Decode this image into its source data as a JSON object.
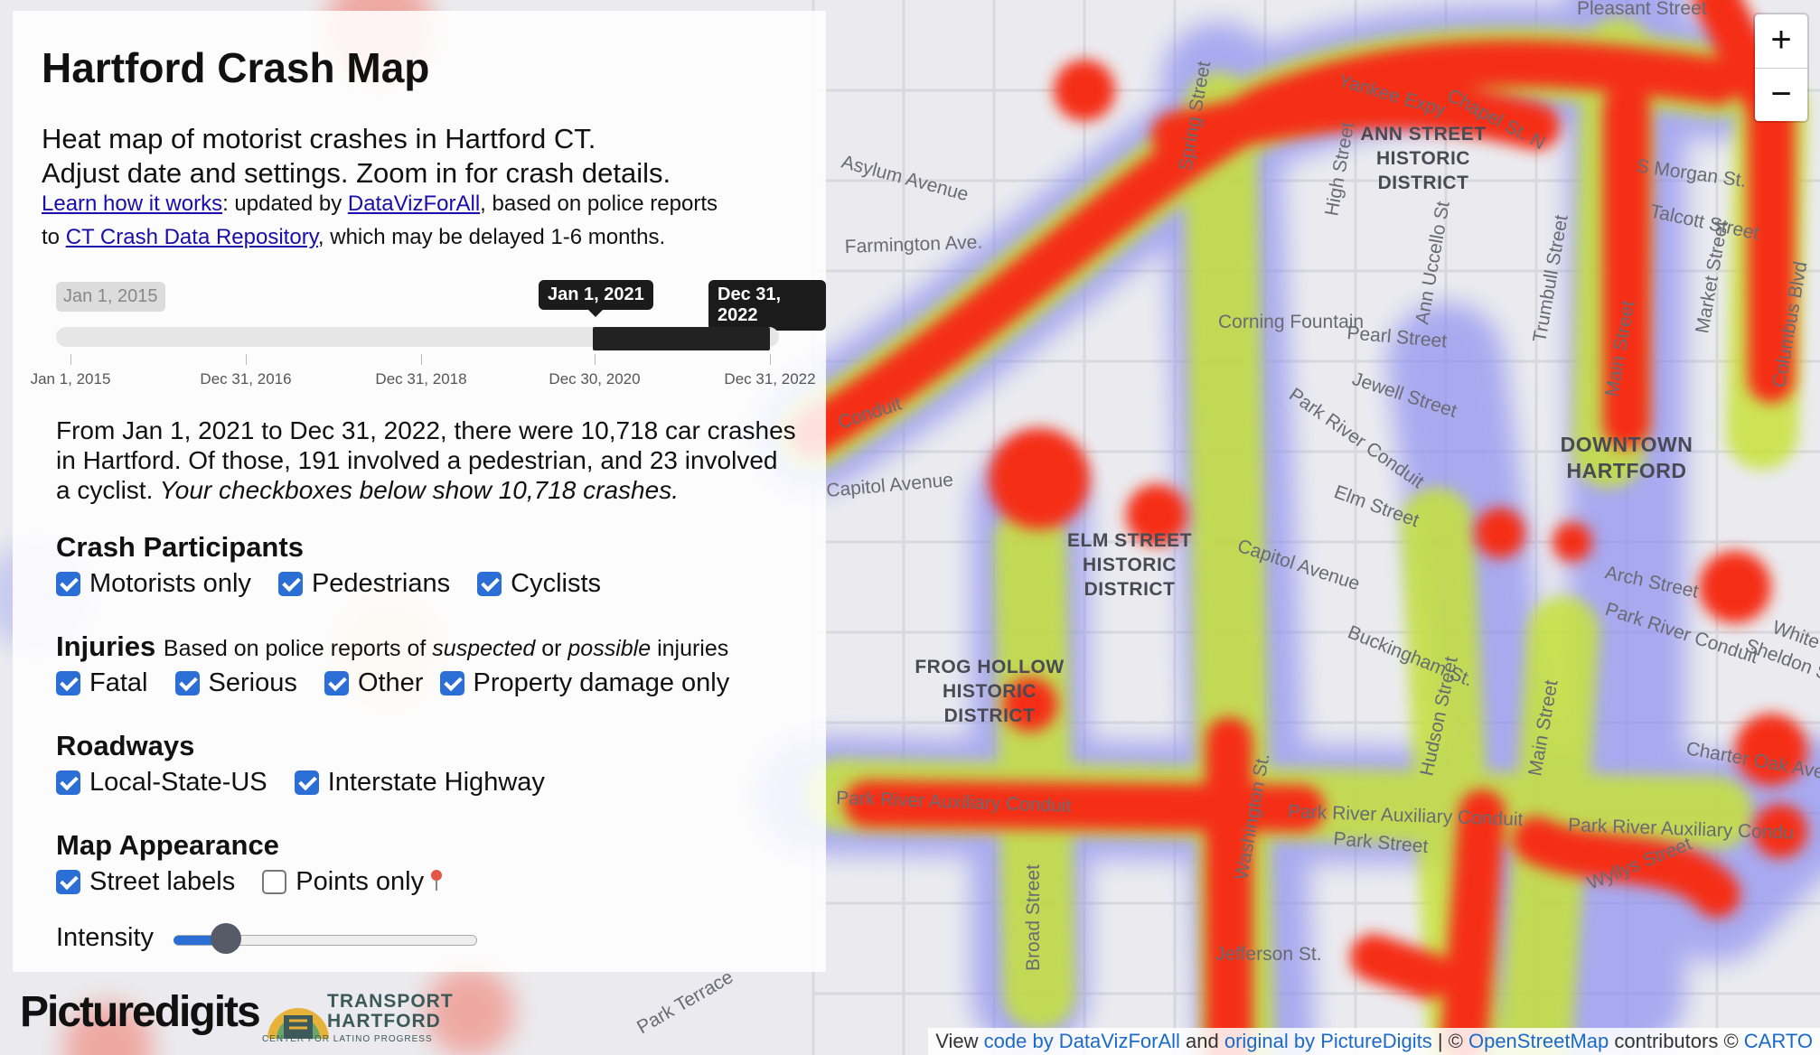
{
  "app": {
    "title": "Hartford Crash Map",
    "intro_line1": "Heat map of motorist crashes in Hartford CT.",
    "intro_line2": "Adjust date and settings. Zoom in for crash details.",
    "learn_link": "Learn how it works",
    "credit_mid": ": updated by ",
    "datavizforall_link": "DataVizForAll",
    "credit_after": ", based on police reports",
    "credit_to": "to ",
    "repo_link": "CT Crash Data Repository",
    "credit_end": ", which may be delayed 1-6 months."
  },
  "date_slider": {
    "min_label": "Jan 1, 2015",
    "start_label": "Jan 1, 2021",
    "end_label": "Dec 31, 2022",
    "ticks": [
      "Jan 1, 2015",
      "Dec 31, 2016",
      "Dec 31, 2018",
      "Dec 30, 2020",
      "Dec 31, 2022"
    ]
  },
  "summary": {
    "text": "From Jan 1, 2021 to Dec 31, 2022, there were 10,718 car crashes in Hartford. Of those, 191 involved a pedestrian, and 23 involved a cyclist.",
    "italic": " Your checkboxes below show 10,718 crashes."
  },
  "participants": {
    "heading": "Crash Participants",
    "options": [
      {
        "label": "Motorists only",
        "checked": true
      },
      {
        "label": "Pedestrians",
        "checked": true
      },
      {
        "label": "Cyclists",
        "checked": true
      }
    ]
  },
  "injuries": {
    "heading": "Injuries",
    "note_pre": "Based on police reports of ",
    "note_em1": "suspected",
    "note_mid": " or ",
    "note_em2": "possible",
    "note_post": " injuries",
    "options": [
      {
        "label": "Fatal",
        "checked": true
      },
      {
        "label": "Serious",
        "checked": true
      },
      {
        "label": "Other",
        "checked": true
      },
      {
        "label": "Property damage only",
        "checked": true
      }
    ]
  },
  "roadways": {
    "heading": "Roadways",
    "options": [
      {
        "label": "Local-State-US",
        "checked": true
      },
      {
        "label": "Interstate Highway",
        "checked": true
      }
    ]
  },
  "appearance": {
    "heading": "Map Appearance",
    "street_labels": {
      "label": "Street labels",
      "checked": true
    },
    "points_only": {
      "label": "Points only",
      "checked": false
    },
    "intensity_label": "Intensity",
    "intensity_value": 0.15
  },
  "logos": {
    "picturedigits": "Picturedigits",
    "transport_line1": "TRANSPORT",
    "transport_line2": "HARTFORD",
    "transport_sub": "CENTER FOR LATINO PROGRESS"
  },
  "zoom": {
    "in": "+",
    "out": "−"
  },
  "attribution": {
    "view": "View ",
    "code_link": "code by DataVizForAll",
    "and": " and ",
    "original_link": "original by PictureDigits",
    "sep": " | © ",
    "osm_link": "OpenStreetMap",
    "contrib": " contributors © ",
    "carto_link": "CARTO"
  },
  "map_labels": {
    "streets": [
      "Pleasant Street",
      "Yankee Expy",
      "Chapel St. N",
      "S Morgan St.",
      "Talcott Street",
      "Spring Street",
      "High Street",
      "Ann Uccello St",
      "Trumbull Street",
      "Main Street",
      "Market Street",
      "Columbus Blvd",
      "Farmington Ave.",
      "Asylum Avenue",
      "Corning Fountain",
      "Pearl Street",
      "Jewell Street",
      "Park River Conduit",
      "Elm Street",
      "Capitol Avenue",
      "Arch Street",
      "Park River Conduit",
      "Buckingham St.",
      "Hudson Street",
      "Main Street",
      "Charter Oak Ave",
      "Park River Auxiliary Conduit",
      "Park River Auxiliary Conduit",
      "Park River Auxiliary Condu",
      "Park Street",
      "Wyllys Street",
      "Washington St.",
      "Broad Street",
      "Jefferson St.",
      "Park Terrace",
      "Capitol Avenue",
      "Conduit",
      "Sheldon Stre",
      "White"
    ],
    "districts": [
      "ANN STREET",
      "HISTORIC",
      "DISTRICT",
      "DOWNTOWN",
      "HARTFORD",
      "ELM STREET",
      "HISTORIC",
      "DISTRICT",
      "FROG HOLLOW",
      "HISTORIC",
      "DISTRICT"
    ]
  }
}
